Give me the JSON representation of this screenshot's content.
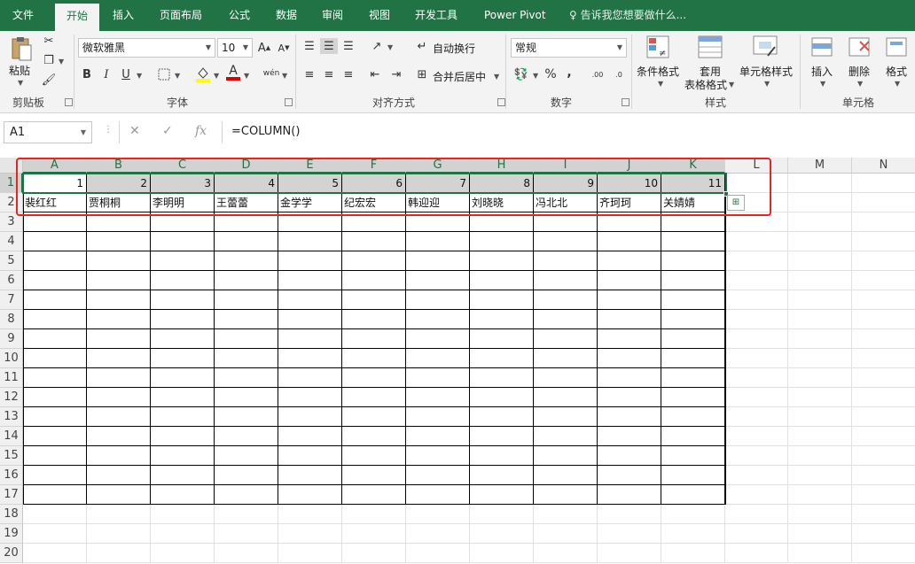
{
  "tabs": [
    {
      "label": "文件"
    },
    {
      "label": "开始",
      "active": true
    },
    {
      "label": "插入"
    },
    {
      "label": "页面布局"
    },
    {
      "label": "公式"
    },
    {
      "label": "数据"
    },
    {
      "label": "审阅"
    },
    {
      "label": "视图"
    },
    {
      "label": "开发工具"
    },
    {
      "label": "Power Pivot"
    }
  ],
  "tell_me": "告诉我您想要做什么...",
  "ribbon": {
    "clipboard": {
      "label": "剪贴板",
      "paste": "粘贴"
    },
    "font": {
      "label": "字体",
      "font_name": "微软雅黑",
      "font_size": "10",
      "bold": "B",
      "italic": "I",
      "underline": "U",
      "font_color": "A",
      "wen": "wén"
    },
    "alignment": {
      "label": "对齐方式",
      "wrap": "自动换行",
      "merge": "合并后居中"
    },
    "number": {
      "label": "数字",
      "format": "常规",
      "percent": "%",
      "comma": ","
    },
    "styles": {
      "label": "样式",
      "conditional": "条件格式",
      "table_format_1": "套用",
      "table_format_2": "表格格式",
      "cell_styles": "单元格样式"
    },
    "cells": {
      "label": "单元格",
      "insert": "插入",
      "delete": "删除",
      "format": "格式"
    }
  },
  "formula_bar": {
    "name_box": "A1",
    "cancel": "✕",
    "enter": "✓",
    "fx": "fx",
    "formula": "=COLUMN()"
  },
  "grid": {
    "columns": [
      "A",
      "B",
      "C",
      "D",
      "E",
      "F",
      "G",
      "H",
      "I",
      "J",
      "K",
      "L",
      "M",
      "N"
    ],
    "rows": [
      "1",
      "2",
      "3",
      "4",
      "5",
      "6",
      "7",
      "8",
      "9",
      "10",
      "11",
      "12",
      "13",
      "14",
      "15",
      "16",
      "17",
      "18",
      "19",
      "20"
    ],
    "row1": [
      "1",
      "2",
      "3",
      "4",
      "5",
      "6",
      "7",
      "8",
      "9",
      "10",
      "11"
    ],
    "row2": [
      "裴红红",
      "贾桐桐",
      "李明明",
      "王蕾蕾",
      "金学学",
      "纪宏宏",
      "韩迎迎",
      "刘晓晓",
      "冯北北",
      "齐珂珂",
      "关婧婧"
    ]
  },
  "colors": {
    "accent": "#217346",
    "highlight_box": "#e8251f",
    "shaded_cell": "#d3d3d3"
  }
}
